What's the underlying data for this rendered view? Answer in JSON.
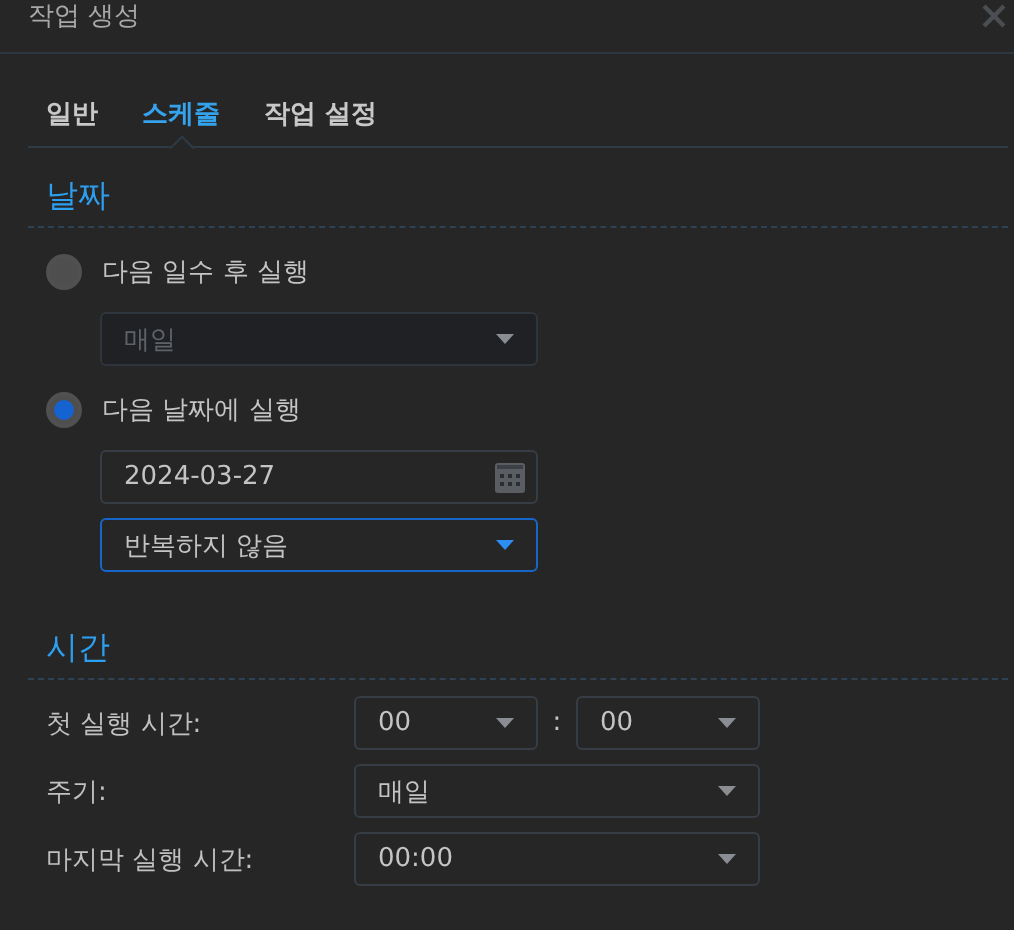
{
  "window": {
    "title": "작업 생성"
  },
  "tabs": [
    {
      "label": "일반",
      "selected": false
    },
    {
      "label": "스케줄",
      "selected": true
    },
    {
      "label": "작업 설정",
      "selected": false
    }
  ],
  "date_section": {
    "title": "날짜",
    "options": [
      {
        "label": "다음 일수 후 실행",
        "selected": false,
        "dropdown": {
          "value": "매일",
          "disabled": true,
          "focused": false
        }
      },
      {
        "label": "다음 날짜에 실행",
        "selected": true,
        "date_field": {
          "value": "2024-03-27"
        },
        "dropdown": {
          "value": "반복하지 않음",
          "disabled": false,
          "focused": true
        }
      }
    ]
  },
  "time_section": {
    "title": "시간",
    "rows": [
      {
        "label": "첫 실행 시간:",
        "kind": "time_pair",
        "values": [
          "00",
          "00"
        ],
        "separator": ":"
      },
      {
        "label": "주기:",
        "kind": "select",
        "value": "매일"
      },
      {
        "label": "마지막 실행 시간:",
        "kind": "select",
        "value": "00:00"
      }
    ]
  }
}
